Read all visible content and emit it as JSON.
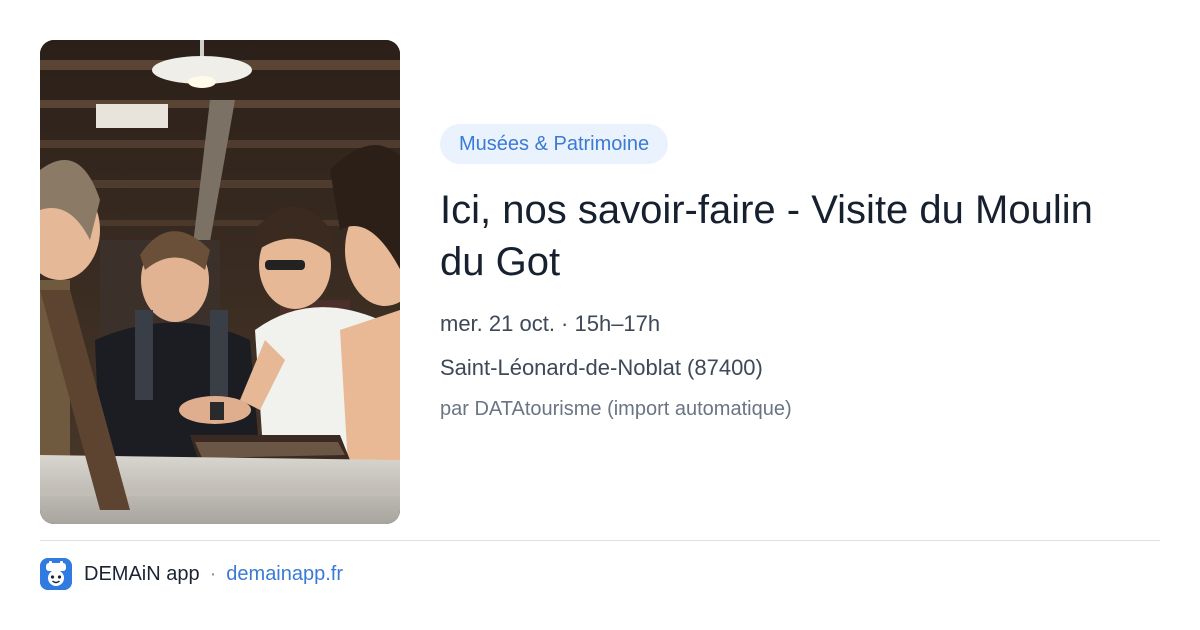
{
  "event": {
    "category": "Musées & Patrimoine",
    "title": "Ici, nos savoir-faire - Visite du Moulin du Got",
    "datetime": "mer. 21 oct. · 15h–17h",
    "location": "Saint-Léonard-de-Noblat (87400)",
    "source": "par DATAtourisme (import automatique)"
  },
  "footer": {
    "app_icon": "demain-app-logo-icon",
    "app_name": "DEMAiN app",
    "separator": "·",
    "link": "demainapp.fr"
  },
  "colors": {
    "accent": "#3a7ad6",
    "badge_bg": "#eaf2fd",
    "app_icon_bg": "#2f7be0"
  }
}
